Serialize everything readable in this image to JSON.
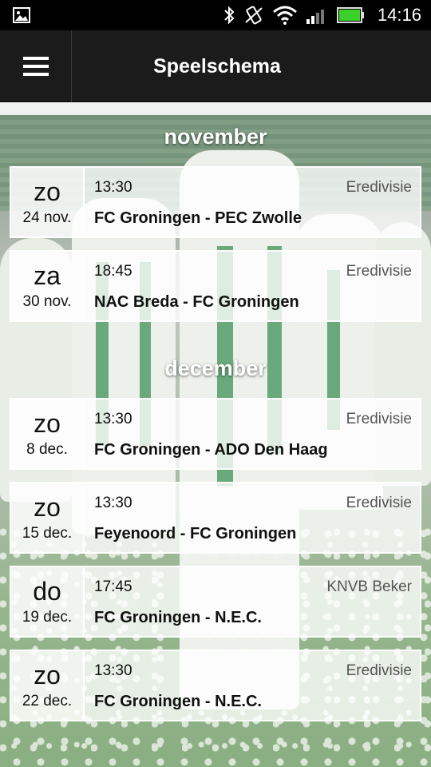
{
  "status_bar": {
    "time": "14:16",
    "icons": [
      "picture-icon",
      "bluetooth-icon",
      "vibrate-icon",
      "wifi-icon",
      "signal-icon",
      "battery-icon"
    ]
  },
  "action_bar": {
    "menu_icon": "hamburger-menu-icon",
    "title": "Speelschema"
  },
  "months": [
    {
      "name": "november",
      "matches": [
        {
          "day": "zo",
          "date": "24 nov.",
          "time": "13:30",
          "competition": "Eredivisie",
          "teams": "FC Groningen - PEC Zwolle"
        },
        {
          "day": "za",
          "date": "30 nov.",
          "time": "18:45",
          "competition": "Eredivisie",
          "teams": "NAC Breda - FC Groningen"
        }
      ]
    },
    {
      "name": "december",
      "matches": [
        {
          "day": "zo",
          "date": "8 dec.",
          "time": "13:30",
          "competition": "Eredivisie",
          "teams": "FC Groningen - ADO Den Haag"
        },
        {
          "day": "zo",
          "date": "15 dec.",
          "time": "13:30",
          "competition": "Eredivisie",
          "teams": "Feyenoord - FC Groningen"
        },
        {
          "day": "do",
          "date": "19 dec.",
          "time": "17:45",
          "competition": "KNVB Beker",
          "teams": "FC Groningen - N.E.C."
        },
        {
          "day": "zo",
          "date": "22 dec.",
          "time": "13:30",
          "competition": "Eredivisie",
          "teams": "FC Groningen - N.E.C."
        }
      ]
    }
  ],
  "colors": {
    "action_bar": "#1b1b1b",
    "status_bar": "#000000",
    "battery": "#3bd12a"
  }
}
